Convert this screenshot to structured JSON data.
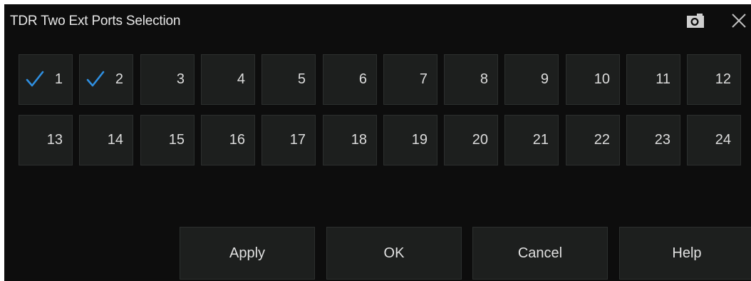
{
  "dialog": {
    "title": "TDR Two Ext Ports Selection",
    "icons": {
      "camera": "camera-icon",
      "close": "close-icon"
    }
  },
  "ports": [
    {
      "label": "1",
      "checked": true
    },
    {
      "label": "2",
      "checked": true
    },
    {
      "label": "3",
      "checked": false
    },
    {
      "label": "4",
      "checked": false
    },
    {
      "label": "5",
      "checked": false
    },
    {
      "label": "6",
      "checked": false
    },
    {
      "label": "7",
      "checked": false
    },
    {
      "label": "8",
      "checked": false
    },
    {
      "label": "9",
      "checked": false
    },
    {
      "label": "10",
      "checked": false
    },
    {
      "label": "11",
      "checked": false
    },
    {
      "label": "12",
      "checked": false
    },
    {
      "label": "13",
      "checked": false
    },
    {
      "label": "14",
      "checked": false
    },
    {
      "label": "15",
      "checked": false
    },
    {
      "label": "16",
      "checked": false
    },
    {
      "label": "17",
      "checked": false
    },
    {
      "label": "18",
      "checked": false
    },
    {
      "label": "19",
      "checked": false
    },
    {
      "label": "20",
      "checked": false
    },
    {
      "label": "21",
      "checked": false
    },
    {
      "label": "22",
      "checked": false
    },
    {
      "label": "23",
      "checked": false
    },
    {
      "label": "24",
      "checked": false
    }
  ],
  "buttons": {
    "apply": "Apply",
    "ok": "OK",
    "cancel": "Cancel",
    "help": "Help"
  },
  "colors": {
    "background": "#0d0d0d",
    "tile": "#1d1f1e",
    "check": "#2f8fe0",
    "text": "#dcdcdc"
  }
}
